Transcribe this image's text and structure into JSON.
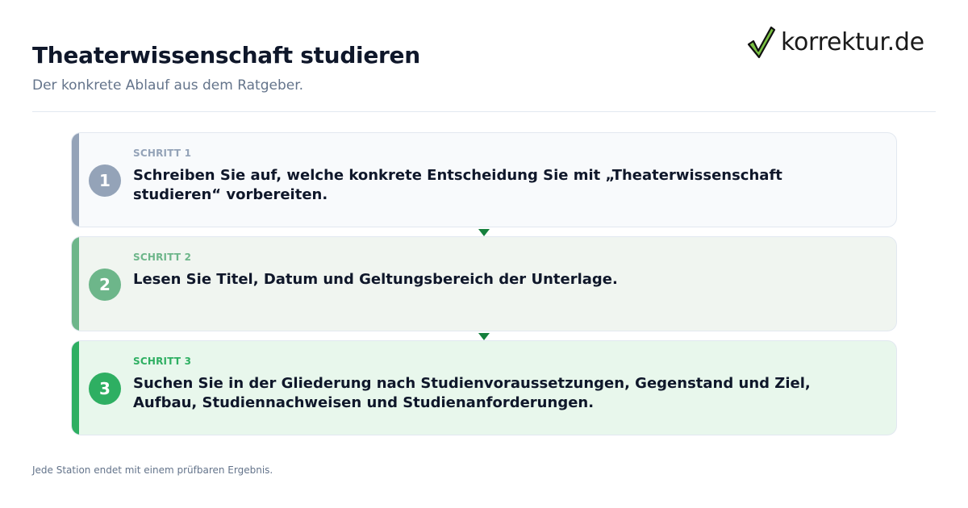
{
  "header": {
    "title": "Theaterwissenschaft studieren",
    "subtitle": "Der konkrete Ablauf aus dem Ratgeber."
  },
  "logo": {
    "icon": "checkmark-icon",
    "text": "korrektur.de",
    "accent": "#3a9d23"
  },
  "steps": [
    {
      "number": "1",
      "label": "SCHRITT 1",
      "text": "Schreiben Sie auf, welche konkrete Entscheidung Sie mit „Theaterwissenschaft studieren“ vorbereiten.",
      "bar_color": "#94a3b8",
      "background": "#f8fafc"
    },
    {
      "number": "2",
      "label": "SCHRITT 2",
      "text": "Lesen Sie Titel, Datum und Geltungsbereich der Unterlage.",
      "bar_color": "#6db68a",
      "background": "#f0f5f0"
    },
    {
      "number": "3",
      "label": "SCHRITT 3",
      "text": "Suchen Sie in der Gliederung nach Studienvoraussetzungen, Gegenstand und Ziel, Aufbau, Studiennachweisen und Studienanforderungen.",
      "bar_color": "#2eaf62",
      "background": "#e8f7ec"
    }
  ],
  "footer": "Jede Station endet mit einem prüfbaren Ergebnis."
}
